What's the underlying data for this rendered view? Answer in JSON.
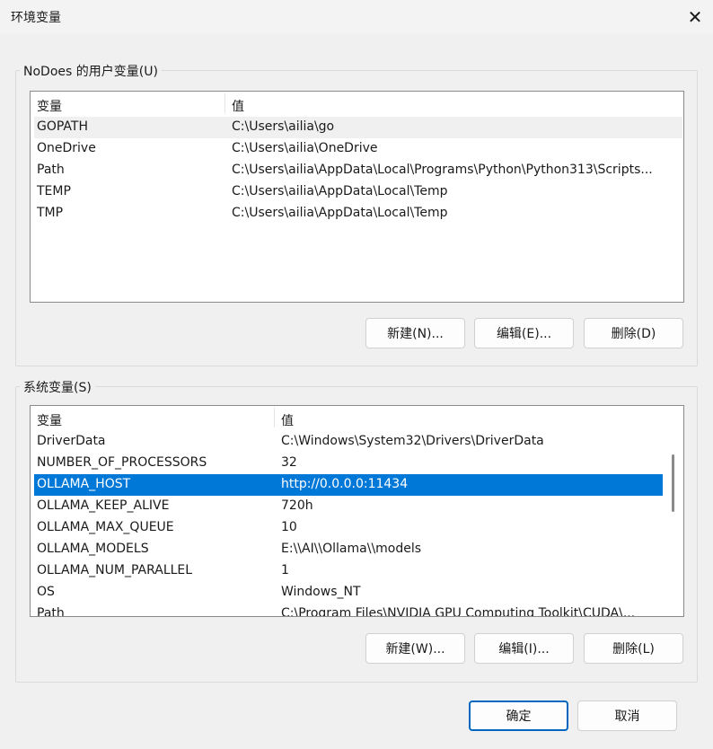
{
  "window": {
    "title": "环境变量",
    "close_icon": "close-icon"
  },
  "user_vars": {
    "group_label": "NoDoes 的用户变量(U)",
    "col_name": "变量",
    "col_value": "值",
    "rows": [
      {
        "name": "GOPATH",
        "value": "C:\\Users\\ailia\\go"
      },
      {
        "name": "OneDrive",
        "value": "C:\\Users\\ailia\\OneDrive"
      },
      {
        "name": "Path",
        "value": "C:\\Users\\ailia\\AppData\\Local\\Programs\\Python\\Python313\\Scripts..."
      },
      {
        "name": "TEMP",
        "value": "C:\\Users\\ailia\\AppData\\Local\\Temp"
      },
      {
        "name": "TMP",
        "value": "C:\\Users\\ailia\\AppData\\Local\\Temp"
      }
    ],
    "new_label": "新建(N)...",
    "edit_label": "编辑(E)...",
    "delete_label": "删除(D)"
  },
  "system_vars": {
    "group_label": "系统变量(S)",
    "col_name": "变量",
    "col_value": "值",
    "rows": [
      {
        "name": "DriverData",
        "value": "C:\\Windows\\System32\\Drivers\\DriverData"
      },
      {
        "name": "NUMBER_OF_PROCESSORS",
        "value": "32"
      },
      {
        "name": "OLLAMA_HOST",
        "value": "http://0.0.0.0:11434"
      },
      {
        "name": "OLLAMA_KEEP_ALIVE",
        "value": "720h"
      },
      {
        "name": "OLLAMA_MAX_QUEUE",
        "value": "10"
      },
      {
        "name": "OLLAMA_MODELS",
        "value": "E:\\\\AI\\\\Ollama\\\\models"
      },
      {
        "name": "OLLAMA_NUM_PARALLEL",
        "value": "1"
      },
      {
        "name": "OS",
        "value": "Windows_NT"
      },
      {
        "name": "Path",
        "value": "C:\\Program Files\\NVIDIA GPU Computing Toolkit\\CUDA\\..."
      }
    ],
    "selected_row": "OLLAMA_HOST",
    "new_label": "新建(W)...",
    "edit_label": "编辑(I)...",
    "delete_label": "删除(L)"
  },
  "footer": {
    "ok_label": "确定",
    "cancel_label": "取消"
  },
  "colors": {
    "selection": "#0078d7",
    "primary_border": "#0067c0"
  }
}
